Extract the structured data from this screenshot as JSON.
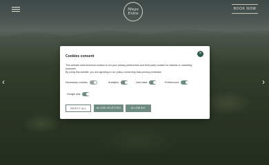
{
  "header": {
    "logo_line1": "Mega",
    "logo_line2": "Extra",
    "book_now_label": "BOOK NOW"
  },
  "icons": {
    "menu": "hamburger-menu-icon",
    "prev": "chevron-left-icon",
    "next": "chevron-right-icon",
    "close": "close-icon"
  },
  "consent": {
    "title": "Cookies consent",
    "description_1": "This website uses technical cookies to set your privacy preferences and third party cookies for statistic or marketing purposes.",
    "description_2": "By using this website, you are agreeing to our policy concerning",
    "policy_link": "Data privacy protection",
    "toggles": [
      {
        "label": "Necessary cookies",
        "enabled": true
      },
      {
        "label": "Analytics",
        "enabled": true
      },
      {
        "label": "User data",
        "enabled": true
      },
      {
        "label": "Preferences",
        "enabled": true
      },
      {
        "label": "Google ads",
        "enabled": true
      }
    ],
    "buttons": {
      "reject_all": "REJECT ALL",
      "allow_selected": "ALLOW SELECTED",
      "allow_all": "ALLOW ALL"
    }
  },
  "colors": {
    "accent": "#6f8c82",
    "close_bg": "#2f5b4c"
  }
}
